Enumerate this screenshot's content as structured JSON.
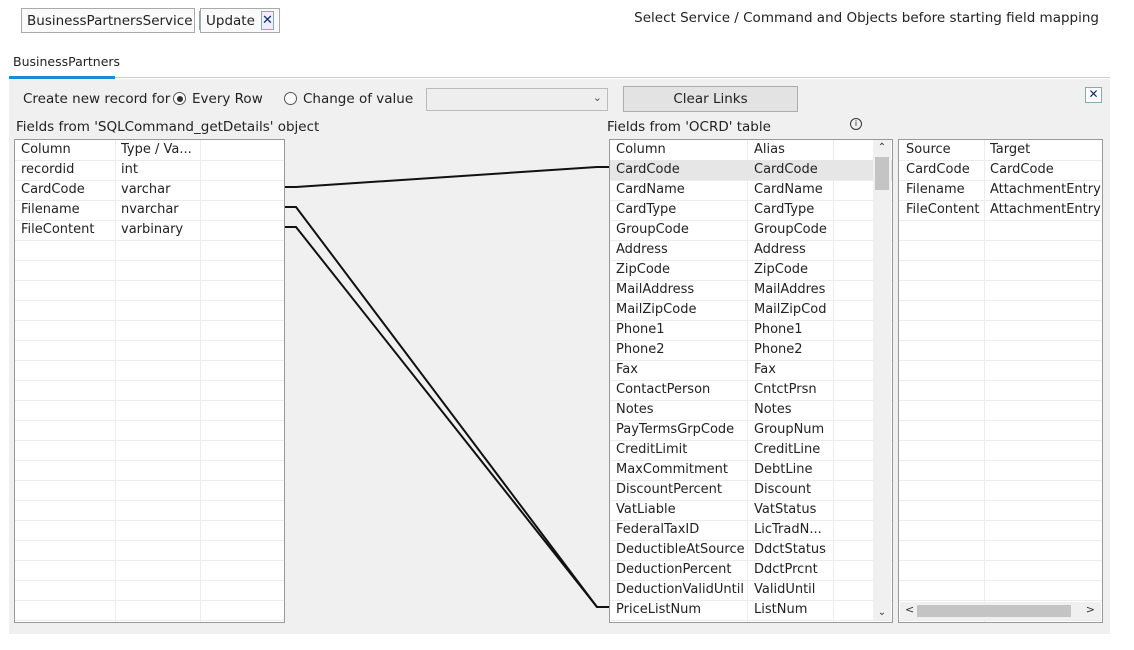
{
  "service_chip": {
    "label": "BusinessPartnersService",
    "close": "✕"
  },
  "command_chip": {
    "label": "Update",
    "close": "✕"
  },
  "hint": "Select Service / Command and Objects before starting field mapping",
  "tab": {
    "label": "BusinessPartners"
  },
  "options": {
    "create_label": "Create new record for",
    "every_row": "Every Row",
    "change_of_value": "Change of value",
    "selected": "every_row",
    "dropdown_value": "",
    "clear_links": "Clear Links",
    "close": "✕"
  },
  "source_grid": {
    "title": "Fields from 'SQLCommand_getDetails' object",
    "headers": [
      "Column",
      "Type / Va..."
    ],
    "rows": [
      [
        "recordid",
        "int"
      ],
      [
        "CardCode",
        "varchar"
      ],
      [
        "Filename",
        "nvarchar"
      ],
      [
        "FileContent",
        "varbinary"
      ]
    ]
  },
  "target_grid": {
    "title": "Fields from 'OCRD' table",
    "headers": [
      "Column",
      "Alias"
    ],
    "rows": [
      [
        "CardCode",
        "CardCode"
      ],
      [
        "CardName",
        "CardName"
      ],
      [
        "CardType",
        "CardType"
      ],
      [
        "GroupCode",
        "GroupCode"
      ],
      [
        "Address",
        "Address"
      ],
      [
        "ZipCode",
        "ZipCode"
      ],
      [
        "MailAddress",
        "MailAddres"
      ],
      [
        "MailZipCode",
        "MailZipCod"
      ],
      [
        "Phone1",
        "Phone1"
      ],
      [
        "Phone2",
        "Phone2"
      ],
      [
        "Fax",
        "Fax"
      ],
      [
        "ContactPerson",
        "CntctPrsn"
      ],
      [
        "Notes",
        "Notes"
      ],
      [
        "PayTermsGrpCode",
        "GroupNum"
      ],
      [
        "CreditLimit",
        "CreditLine"
      ],
      [
        "MaxCommitment",
        "DebtLine"
      ],
      [
        "DiscountPercent",
        "Discount"
      ],
      [
        "VatLiable",
        "VatStatus"
      ],
      [
        "FederalTaxID",
        "LicTradN..."
      ],
      [
        "DeductibleAtSource",
        "DdctStatus"
      ],
      [
        "DeductionPercent",
        "DdctPrcnt"
      ],
      [
        "DeductionValidUntil",
        "ValidUntil"
      ],
      [
        "PriceListNum",
        "ListNum"
      ]
    ]
  },
  "mapping_grid": {
    "headers": [
      "Source",
      "Target"
    ],
    "rows": [
      [
        "CardCode",
        "CardCode"
      ],
      [
        "Filename",
        "AttachmentEntry"
      ],
      [
        "FileContent",
        "AttachmentEntry"
      ]
    ]
  },
  "links": [
    {
      "source": "CardCode",
      "target": "CardCode"
    },
    {
      "source": "Filename",
      "target": "PriceListNum"
    },
    {
      "source": "FileContent",
      "target": "PriceListNum"
    }
  ],
  "colors": {
    "tab_accent": "#1e8ad6",
    "icon_navy": "#0d2a6a"
  }
}
